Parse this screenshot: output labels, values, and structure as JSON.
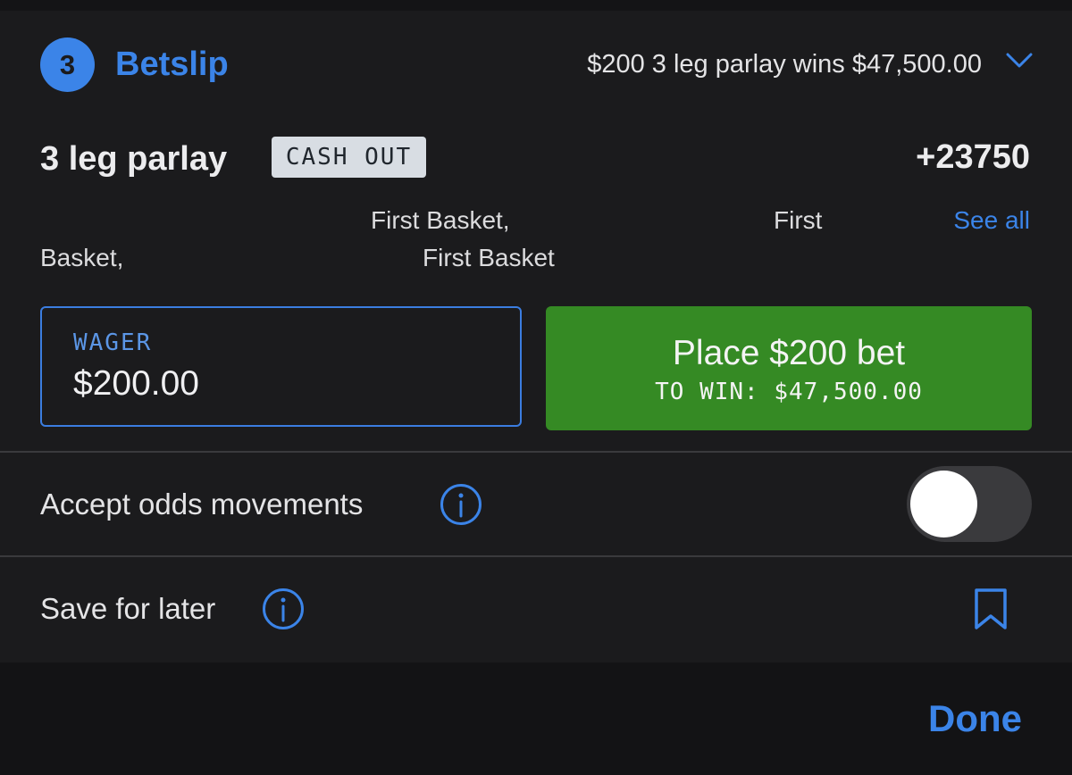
{
  "header": {
    "count": "3",
    "title": "Betslip",
    "summary": "$200 3 leg parlay wins $47,500.00",
    "accent_color": "#3b84e8"
  },
  "parlay": {
    "label": "3 leg parlay",
    "cash_out_badge": "CASH OUT",
    "odds": "+23750"
  },
  "legs": {
    "items": [
      "First Basket,",
      "First",
      "Basket,",
      "First Basket"
    ],
    "see_all": "See all"
  },
  "wager": {
    "label": "WAGER",
    "value": "$200.00"
  },
  "place_bet": {
    "label": "Place $200 bet",
    "to_win": "TO WIN: $47,500.00",
    "color": "#358a24"
  },
  "settings": {
    "accept_odds": {
      "label": "Accept odds movements",
      "enabled": false
    },
    "save_for_later": {
      "label": "Save for later"
    }
  },
  "footer": {
    "done_label": "Done"
  },
  "icons": [
    "chevron-down-icon",
    "info-icon",
    "bookmark-icon"
  ]
}
